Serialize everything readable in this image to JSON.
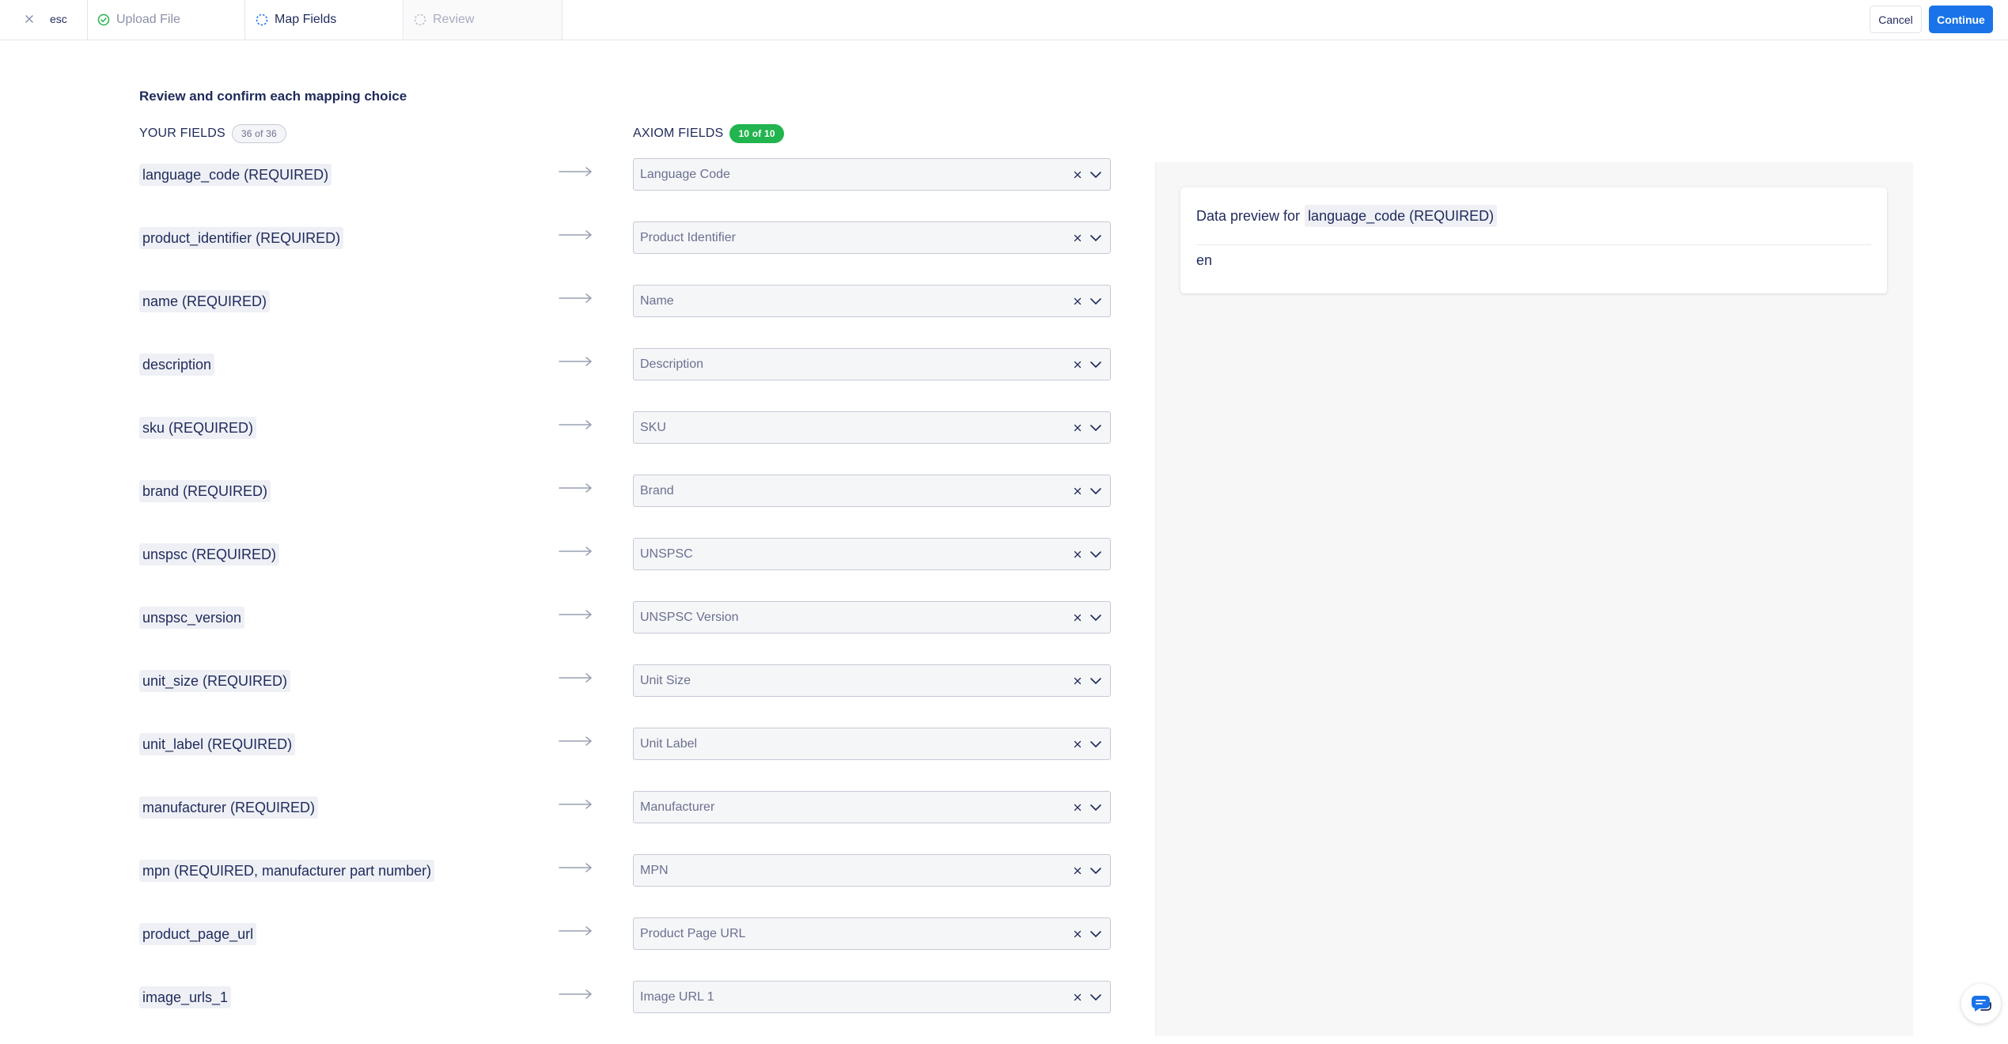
{
  "topbar": {
    "esc_label": "esc",
    "steps": [
      {
        "label": "Upload File",
        "state": "complete"
      },
      {
        "label": "Map Fields",
        "state": "active"
      },
      {
        "label": "Review",
        "state": "pending"
      }
    ],
    "cancel_label": "Cancel",
    "continue_label": "Continue"
  },
  "page": {
    "title": "Review and confirm each mapping choice"
  },
  "your_fields": {
    "heading": "YOUR FIELDS",
    "count": "36 of 36"
  },
  "axiom_fields": {
    "heading": "AXIOM FIELDS",
    "count": "10 of 10"
  },
  "mappings": [
    {
      "source": "language_code (REQUIRED)",
      "target": "Language Code"
    },
    {
      "source": "product_identifier (REQUIRED)",
      "target": "Product Identifier"
    },
    {
      "source": "name (REQUIRED)",
      "target": "Name"
    },
    {
      "source": "description",
      "target": "Description"
    },
    {
      "source": "sku (REQUIRED)",
      "target": "SKU"
    },
    {
      "source": "brand (REQUIRED)",
      "target": "Brand"
    },
    {
      "source": "unspsc (REQUIRED)",
      "target": "UNSPSC"
    },
    {
      "source": "unspsc_version",
      "target": "UNSPSC Version"
    },
    {
      "source": "unit_size (REQUIRED)",
      "target": "Unit Size"
    },
    {
      "source": "unit_label (REQUIRED)",
      "target": "Unit Label"
    },
    {
      "source": "manufacturer (REQUIRED)",
      "target": "Manufacturer"
    },
    {
      "source": "mpn (REQUIRED, manufacturer part number)",
      "target": "MPN"
    },
    {
      "source": "product_page_url",
      "target": "Product Page URL"
    },
    {
      "source": "image_urls_1",
      "target": "Image URL 1"
    }
  ],
  "preview": {
    "title_prefix": "Data preview for",
    "field": "language_code (REQUIRED)",
    "value": "en"
  },
  "colors": {
    "accent": "#1a73e8",
    "success": "#22b44e",
    "text": "#1f2a5a"
  },
  "icons": {
    "close": "close-icon",
    "step_complete": "check-circle-icon",
    "step_active": "dashed-circle-icon",
    "arrow": "long-arrow-right-icon",
    "clear": "clear-icon",
    "chevron": "chevron-down-icon",
    "chat": "chat-icon"
  }
}
